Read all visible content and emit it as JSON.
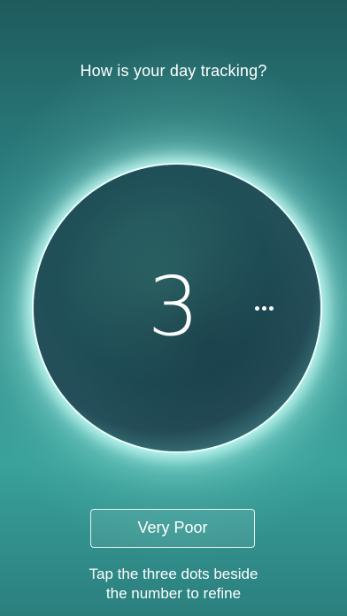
{
  "prompt": {
    "question": "How is your day tracking?"
  },
  "rating": {
    "score": "3",
    "more_icon": "ellipsis-horizontal",
    "label": "Very Poor"
  },
  "hint": {
    "line1": "Tap the three dots beside",
    "line2": "the number to refine"
  },
  "colors": {
    "background_top": "#1f5b5d",
    "background_bottom": "#2a7f7d",
    "orb_core": "#1f4f57",
    "orb_rim": "#c9fbf3",
    "text": "#ffffff"
  }
}
